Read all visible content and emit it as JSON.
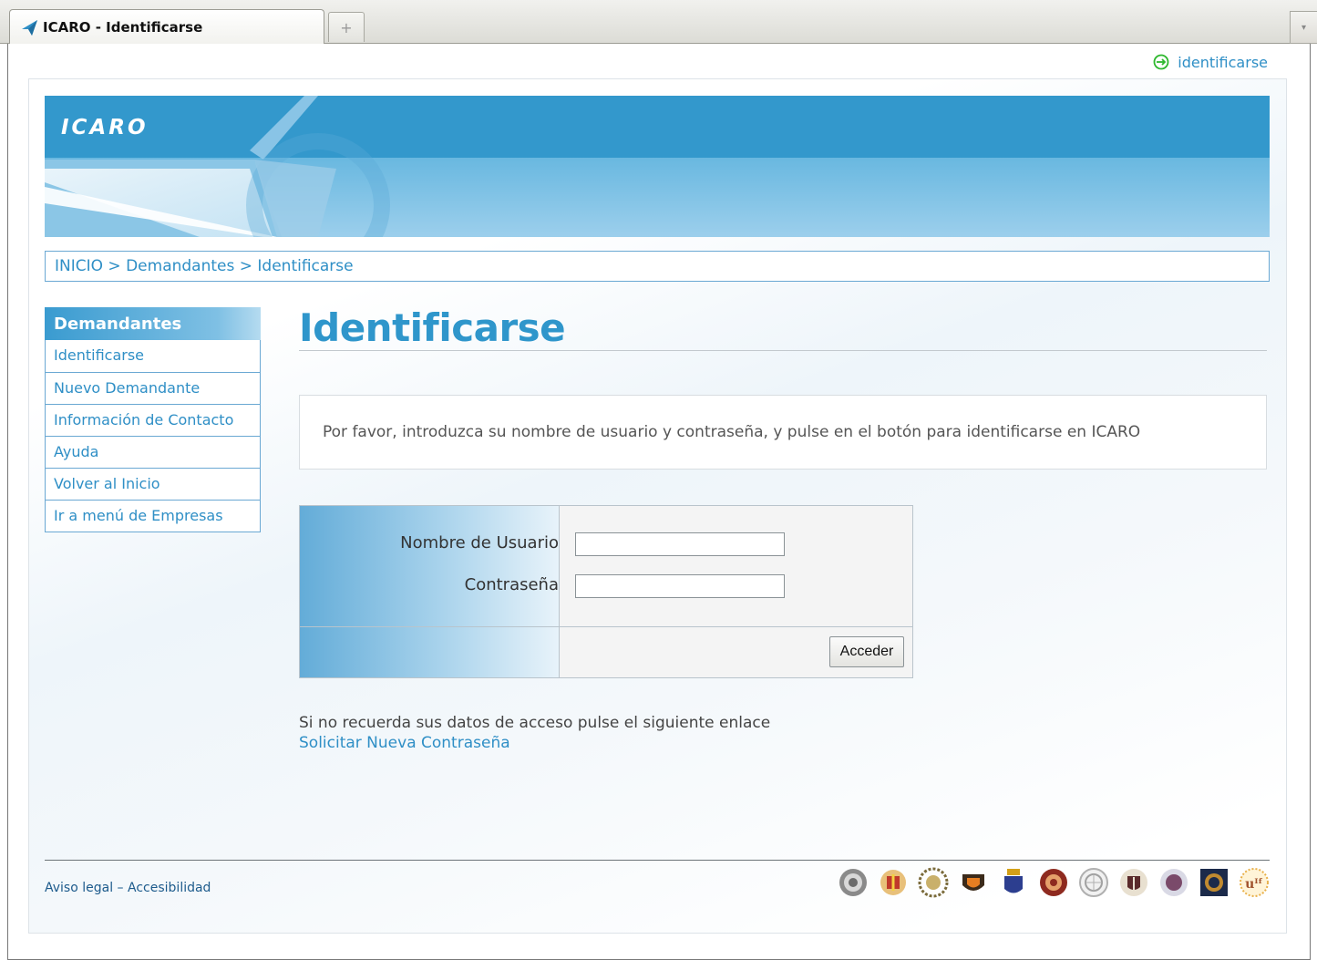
{
  "browser": {
    "tab_title": "ICARO - Identificarse",
    "new_tab_symbol": "+",
    "scroll_symbol": "▾"
  },
  "top_login_link": "identificarse",
  "banner": {
    "logo_text": "ICARO"
  },
  "breadcrumb": {
    "items": [
      "INICIO",
      "Demandantes",
      "Identificarse"
    ],
    "separator": " > "
  },
  "sidebar": {
    "title": "Demandantes",
    "items": [
      {
        "label": "Identificarse"
      },
      {
        "label": "Nuevo Demandante"
      },
      {
        "label": "Información de Contacto"
      },
      {
        "label": "Ayuda"
      },
      {
        "label": "Volver al Inicio"
      },
      {
        "label": "Ir a menú de Empresas"
      }
    ]
  },
  "main": {
    "title": "Identificarse",
    "info_text": "Por favor, introduzca su nombre de usuario y contraseña, y pulse en el botón para identificarse en ICARO",
    "form": {
      "username_label": "Nombre de Usuario",
      "username_value": "",
      "password_label": "Contraseña",
      "password_value": "",
      "submit_label": "Acceder"
    },
    "recover_text": "Si no recuerda sus datos de acceso pulse el siguiente enlace",
    "recover_link": "Solicitar Nueva Contraseña"
  },
  "footer": {
    "legal_link": "Aviso legal",
    "link_separator": " – ",
    "accessibility_link": "Accesibilidad",
    "seal_icons": [
      "seal-icon",
      "seal-icon",
      "seal-icon",
      "seal-icon",
      "seal-icon",
      "seal-icon",
      "seal-icon",
      "seal-icon",
      "seal-icon",
      "seal-icon",
      "seal-icon"
    ]
  },
  "colors": {
    "accent": "#2f96cb",
    "banner_top": "#3398cc",
    "banner_bottom": "#9ccfec",
    "link": "#2f8fc6",
    "footer_link": "#1d5b8c",
    "login_icon": "#2eb82e"
  }
}
